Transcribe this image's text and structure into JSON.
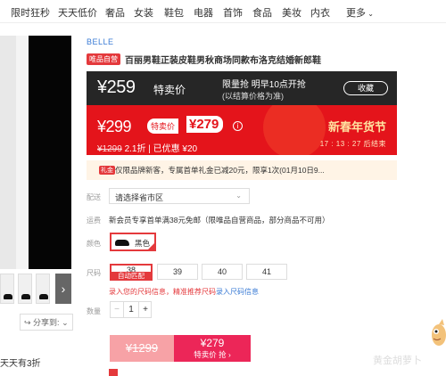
{
  "nav": {
    "items": [
      "限时狂秒",
      "天天低价",
      "奢品",
      "女装",
      "鞋包",
      "电器",
      "首饰",
      "食品",
      "美妆",
      "内衣",
      "更多"
    ]
  },
  "gallery": {
    "share_label": "分享到:",
    "next_icon": "chevron-right-icon"
  },
  "daily_text": "天天有3折",
  "product": {
    "brand": "BELLE",
    "tag": "唯品自营",
    "title": "百丽男鞋正装皮鞋男秋商场同款布洛克结婚新郎鞋"
  },
  "flash_banner": {
    "price": "¥259",
    "type": "特卖价",
    "line1": "限量抢 明早10点开抢",
    "line2": "(以结算价格为准)",
    "button": "收藏"
  },
  "sale_banner": {
    "price": "¥299",
    "tag_label": "特卖价",
    "tag_price": "¥279",
    "info_icon": "i",
    "original": "¥1299",
    "discount": "2.1折 | 已优惠 ¥20",
    "festival": "新春年货节",
    "countdown": "17 : 13 : 27 后结束"
  },
  "gift": {
    "tag": "礼金",
    "text": "仅限品牌新客，专属首单礼金已减20元，限享1次(01月10日9..."
  },
  "delivery": {
    "label": "配送",
    "select": "请选择省市区",
    "chevron": "⌄"
  },
  "shipping": {
    "label": "运费",
    "text": "新会员专享首单满38元免邮（限唯品自营商品，部分商品不可用）"
  },
  "color": {
    "label": "颜色",
    "value": "黑色"
  },
  "size": {
    "label": "尺码",
    "options": [
      "38",
      "39",
      "40",
      "41"
    ],
    "auto_badge": "自动匹配",
    "link_red": "录入您的尺码信息，精准推荐尺码",
    "link_blue": "录入尺码信息"
  },
  "quantity": {
    "label": "数量",
    "minus": "−",
    "value": "1",
    "plus": "+"
  },
  "buy": {
    "original": "¥1299",
    "price": "¥279",
    "cta": "特卖价 抢 ›"
  },
  "watermark": "黄金胡萝卜",
  "colors": {
    "accent_red": "#e4393c",
    "banner_red": "#e4141b",
    "buy_pink": "#ec2658",
    "link_blue": "#3a7bd5"
  }
}
